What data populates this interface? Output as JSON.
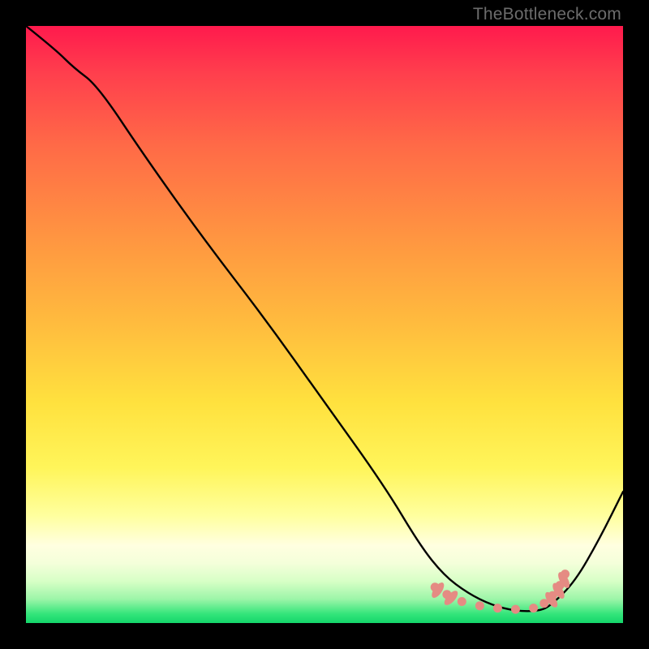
{
  "watermark": "TheBottleneck.com",
  "chart_data": {
    "type": "line",
    "title": "",
    "xlabel": "",
    "ylabel": "",
    "xlim": [
      0,
      100
    ],
    "ylim": [
      0,
      100
    ],
    "series": [
      {
        "name": "bottleneck-curve",
        "x": [
          0,
          5,
          8,
          12,
          20,
          30,
          40,
          50,
          60,
          66,
          70,
          74,
          78,
          82,
          86,
          88,
          92,
          96,
          100
        ],
        "y": [
          100,
          96,
          93,
          90,
          78,
          64,
          51,
          37,
          23,
          13,
          8,
          5,
          3,
          2,
          2,
          3,
          7,
          14,
          22
        ]
      }
    ],
    "markers": {
      "name": "salmon-dots",
      "color": "#e58b83",
      "x": [
        68.5,
        70.5,
        73,
        76,
        79,
        82,
        85,
        86.8,
        88.2,
        89.4,
        90.3
      ],
      "y": [
        6.0,
        4.8,
        3.6,
        2.9,
        2.5,
        2.3,
        2.5,
        3.3,
        4.6,
        6.3,
        8.2
      ],
      "ellipses": [
        {
          "x": 69.0,
          "y": 5.5,
          "rot": -55
        },
        {
          "x": 71.2,
          "y": 4.2,
          "rot": -48
        },
        {
          "x": 88.0,
          "y": 3.9,
          "rot": 55
        },
        {
          "x": 89.2,
          "y": 5.4,
          "rot": 58
        },
        {
          "x": 90.1,
          "y": 7.2,
          "rot": 60
        }
      ]
    },
    "gradient_stops": [
      {
        "pos": 0.0,
        "color": "#ff1a4d"
      },
      {
        "pos": 0.35,
        "color": "#ff9441"
      },
      {
        "pos": 0.63,
        "color": "#ffe13e"
      },
      {
        "pos": 0.87,
        "color": "#ffffe0"
      },
      {
        "pos": 1.0,
        "color": "#14d66b"
      }
    ]
  }
}
